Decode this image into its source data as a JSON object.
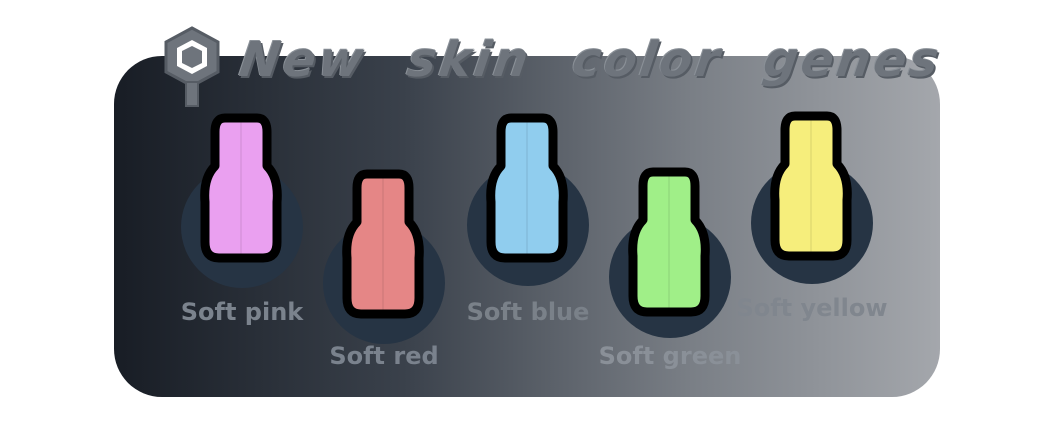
{
  "title": {
    "text": "New skin color genes",
    "logo_icon": "gear-hex-icon"
  },
  "genes": [
    {
      "label": "Soft pink",
      "color": "#eaa0f0",
      "label_color": "#7b838d"
    },
    {
      "label": "Soft red",
      "color": "#e58686",
      "label_color": "#7a828d"
    },
    {
      "label": "Soft blue",
      "color": "#90cdee",
      "label_color": "#7a8189"
    },
    {
      "label": "Soft green",
      "color": "#a0ef88",
      "label_color": "#8a9098"
    },
    {
      "label": "Soft yellow",
      "color": "#f6ee7c",
      "label_color": "#80868e"
    }
  ],
  "colors": {
    "disc": "#263444",
    "outline": "#000000"
  }
}
